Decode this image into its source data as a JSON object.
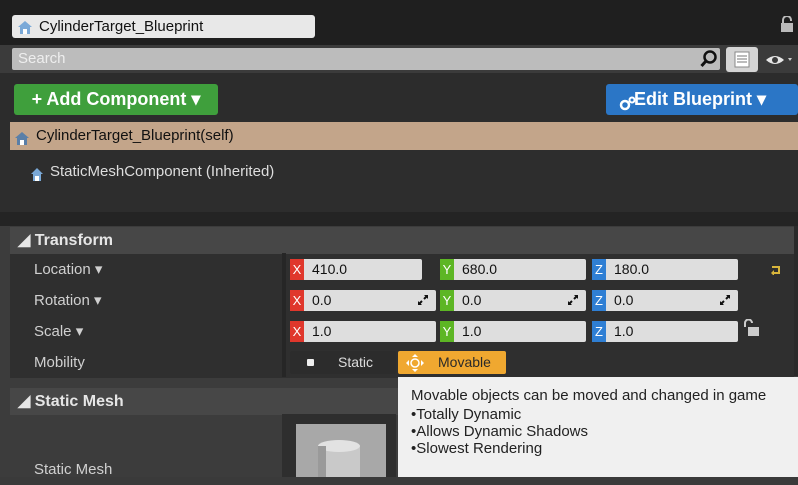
{
  "header": {
    "blueprint_name": "CylinderTarget_Blueprint",
    "search_placeholder": "Search"
  },
  "toolbar": {
    "add_component_label": "+ Add Component ▾",
    "edit_blueprint_label": "Edit Blueprint ▾"
  },
  "components": {
    "root_label": "CylinderTarget_Blueprint(self)",
    "child_label": "StaticMeshComponent (Inherited)"
  },
  "transform": {
    "header": "◢ Transform",
    "location": {
      "label": "Location ▾",
      "x": "410.0",
      "y": "680.0",
      "z": "180.0"
    },
    "rotation": {
      "label": "Rotation ▾",
      "x": "0.0",
      "y": "0.0",
      "z": "0.0"
    },
    "scale": {
      "label": "Scale ▾",
      "x": "1.0",
      "y": "1.0",
      "z": "1.0"
    },
    "mobility": {
      "label": "Mobility",
      "static_label": "Static",
      "movable_label": "Movable",
      "selected": "Movable"
    },
    "axis_labels": {
      "x": "X",
      "y": "Y",
      "z": "Z"
    }
  },
  "tooltip": {
    "text": "Movable objects can be moved and changed in game",
    "bullets": [
      "Totally Dynamic",
      "Allows Dynamic Shadows",
      "Slowest Rendering"
    ]
  },
  "static_mesh": {
    "header": "◢ Static Mesh",
    "label": "Static Mesh"
  },
  "colors": {
    "add_button": "#3f9f3c",
    "edit_button": "#2b76c6",
    "selected_row": "#c3a58a",
    "movable_selected": "#f0a830",
    "axis_x": "#e0372c",
    "axis_y": "#5db624",
    "axis_z": "#2f7fd4"
  },
  "icons": [
    "blueprint-icon",
    "lock-icon",
    "search-icon",
    "list-view-icon",
    "eye-icon",
    "gear-icon",
    "spinner-arrows-icon",
    "reset-arrow-icon",
    "move-arrows-icon"
  ]
}
